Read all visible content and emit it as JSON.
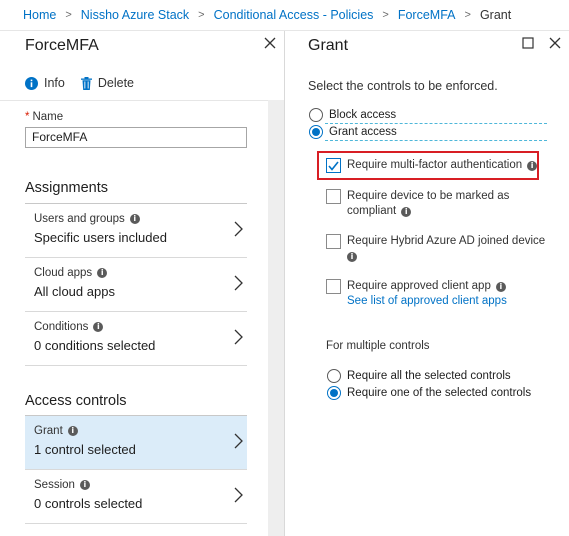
{
  "breadcrumb": {
    "items": [
      "Home",
      "Nissho Azure Stack",
      "Conditional Access - Policies",
      "ForceMFA"
    ],
    "current": "Grant",
    "separator": ">"
  },
  "left_blade": {
    "title": "ForceMFA",
    "commands": {
      "info": "Info",
      "delete": "Delete"
    },
    "name_field": {
      "required_marker": "*",
      "label": "Name",
      "value": "ForceMFA"
    },
    "assignments": {
      "heading": "Assignments",
      "users": {
        "label": "Users and groups",
        "value": "Specific users included"
      },
      "cloud_apps": {
        "label": "Cloud apps",
        "value": "All cloud apps"
      },
      "conditions": {
        "label": "Conditions",
        "value": "0 conditions selected"
      }
    },
    "access_controls": {
      "heading": "Access controls",
      "grant": {
        "label": "Grant",
        "value": "1 control selected"
      },
      "session": {
        "label": "Session",
        "value": "0 controls selected"
      }
    }
  },
  "right_blade": {
    "title": "Grant",
    "instruction": "Select the controls to be enforced.",
    "block_access": {
      "label": "Block access",
      "checked": false
    },
    "grant_access": {
      "label": "Grant access",
      "checked": true
    },
    "controls": {
      "mfa": {
        "label": "Require multi-factor authentication",
        "checked": true
      },
      "compliant": {
        "line1": "Require device to be marked as",
        "line2": "compliant",
        "checked": false
      },
      "hybrid": {
        "label": "Require Hybrid Azure AD joined device",
        "checked": false
      },
      "approved_app": {
        "label": "Require approved client app",
        "link": "See list of approved client apps",
        "checked": false
      }
    },
    "multiple_controls": {
      "label": "For multiple controls",
      "require_all": {
        "label": "Require all the selected controls",
        "checked": false
      },
      "require_one": {
        "label": "Require one of the selected controls",
        "checked": true
      }
    }
  },
  "colors": {
    "accent": "#0072c6",
    "selected_background": "#dbecf9",
    "highlight_border": "#d81e24",
    "required_marker": "#d81e05"
  },
  "icons": [
    "info-icon",
    "trash-icon",
    "close-icon",
    "maximize-icon",
    "chevron-right-icon",
    "checkmark-icon"
  ]
}
